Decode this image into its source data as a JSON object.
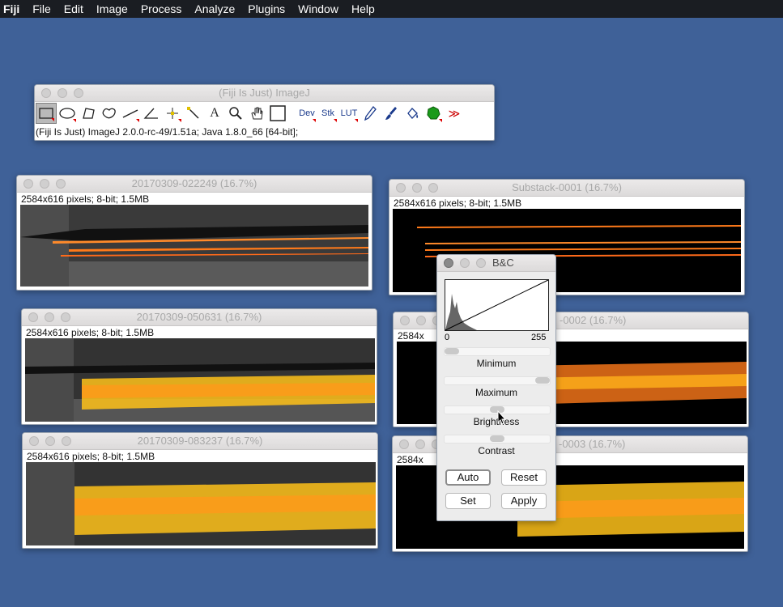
{
  "menubar": {
    "app": "Fiji",
    "items": [
      "File",
      "Edit",
      "Image",
      "Process",
      "Analyze",
      "Plugins",
      "Window",
      "Help"
    ]
  },
  "imagej": {
    "title": "(Fiji Is Just) ImageJ",
    "status": "(Fiji Is Just) ImageJ 2.0.0-rc-49/1.51a; Java 1.8.0_66 [64-bit];",
    "tools": {
      "text": "A",
      "dev": "Dev",
      "stk": "Stk",
      "lut": "LUT",
      "more": "≫"
    }
  },
  "windows": {
    "w1": {
      "title": "20170309-022249 (16.7%)",
      "info": "2584x616 pixels; 8-bit; 1.5MB"
    },
    "w2": {
      "title": "20170309-050631 (16.7%)",
      "info": "2584x616 pixels; 8-bit; 1.5MB"
    },
    "w3": {
      "title": "20170309-083237 (16.7%)",
      "info": "2584x616 pixels; 8-bit; 1.5MB"
    },
    "w4": {
      "title": "Substack-0001 (16.7%)",
      "info": "2584x616 pixels; 8-bit; 1.5MB"
    },
    "w5": {
      "title": "-0002 (16.7%)",
      "info": "2584x"
    },
    "w6": {
      "title": "-0003 (16.7%)",
      "info": "2584x"
    }
  },
  "bc": {
    "title": "B&C",
    "hist_min": "0",
    "hist_max": "255",
    "minimum_label": "Minimum",
    "maximum_label": "Maximum",
    "brightness_label": "Brightness",
    "contrast_label": "Contrast",
    "minimum_level": 0.0,
    "maximum_level": 1.0,
    "brightness_level": 0.5,
    "contrast_level": 0.5,
    "buttons": {
      "auto": "Auto",
      "reset": "Reset",
      "set": "Set",
      "apply": "Apply"
    }
  },
  "colors": {
    "desktop": "#3f6198",
    "menubar": "#1a1d22",
    "image_orange": "#ff7a1a",
    "image_yellow": "#ffc21a"
  }
}
